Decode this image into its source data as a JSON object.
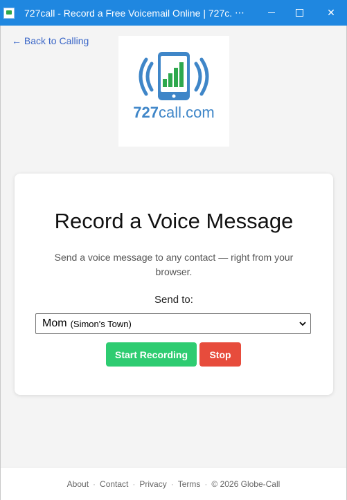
{
  "window": {
    "title": "727call - Record a Free Voicemail Online | 727c...",
    "more_label": "⋯",
    "close_label": "✕"
  },
  "nav": {
    "back_label": "← Back to Calling"
  },
  "logo": {
    "text_bold": "727",
    "text_light": "call.com"
  },
  "card": {
    "title": "Record a Voice Message",
    "description": "Send a voice message to any contact — right from your browser.",
    "send_to_label": "Send to:",
    "contact_select": {
      "selected_name": "Mom",
      "selected_place": "(Simon's Town)"
    },
    "start_label": "Start Recording",
    "stop_label": "Stop"
  },
  "footer": {
    "links": [
      "About",
      "Contact",
      "Privacy",
      "Terms"
    ],
    "copyright": "© 2026 Globe-Call"
  },
  "colors": {
    "titlebar": "#1f87e0",
    "start_button": "#2ecc71",
    "stop_button": "#e74c3c",
    "logo_blue": "#3f86c8",
    "logo_green": "#2ea84d",
    "link": "#3a66c7"
  }
}
